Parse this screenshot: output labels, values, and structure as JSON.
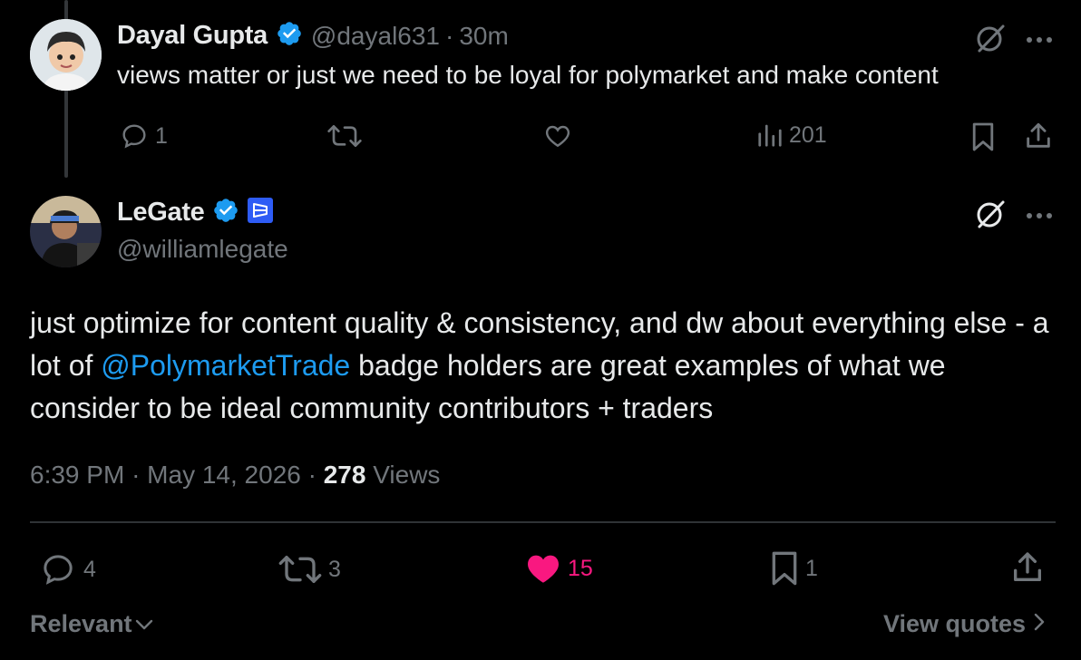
{
  "reply": {
    "author_name": "Dayal Gupta",
    "handle": "@dayal631",
    "separator": "·",
    "time": "30m",
    "text": "views matter or just we need to be loyal for polymarket and make content",
    "reply_count": "1",
    "view_count": "201"
  },
  "main_post": {
    "author_name": "LeGate",
    "handle": "@williamlegate",
    "text_before": "just optimize for content quality & consistency, and dw about everything else - a lot of ",
    "mention": "@PolymarketTrade",
    "text_after": " badge holders are great examples of what we consider to be ideal community contributors + traders",
    "time": "6:39 PM",
    "dot1": "·",
    "date": "May 14, 2026",
    "dot2": "·",
    "views_count": "278",
    "views_label": "Views",
    "reply_count": "4",
    "repost_count": "3",
    "like_count": "15",
    "bookmark_count": "1"
  },
  "footer": {
    "sort_label": "Relevant",
    "view_quotes_label": "View quotes"
  },
  "colors": {
    "background": "#000000",
    "text": "#e7e9ea",
    "muted": "#71767b",
    "mention": "#1d9bf0",
    "verified": "#1d9bf0",
    "like": "#f91880"
  }
}
